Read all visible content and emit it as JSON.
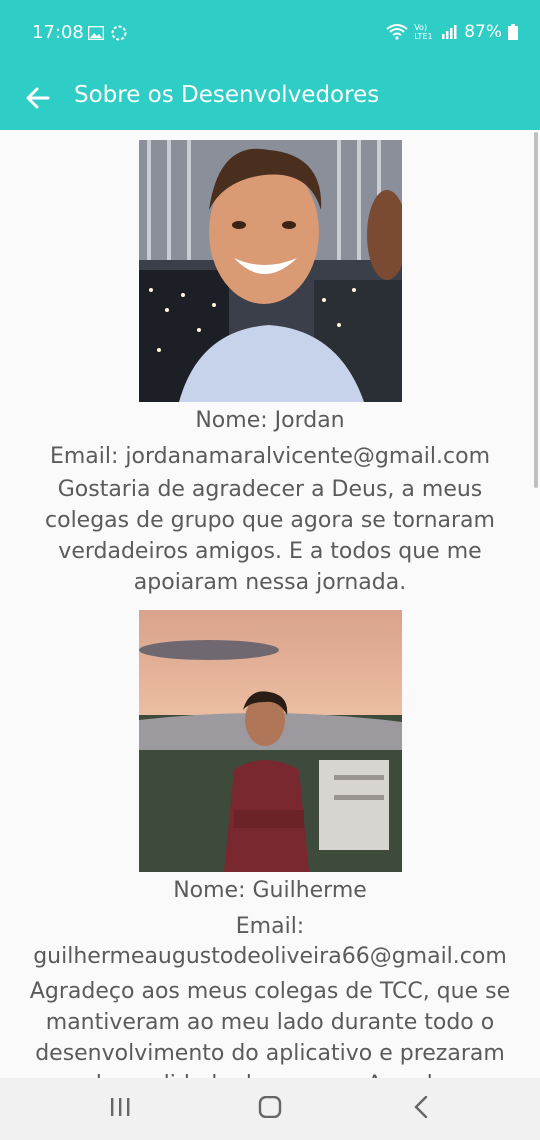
{
  "status": {
    "time": "17:08",
    "battery": "87%",
    "network": "Vo) LTE1"
  },
  "appbar": {
    "title": "Sobre os Desenvolvedores"
  },
  "developers": [
    {
      "name": "Nome: Jordan",
      "email": "Email: jordanamaralvicente@gmail.com",
      "message": "Gostaria de agradecer a Deus, a meus colegas de grupo que agora se tornaram verdadeiros amigos. E a todos que me apoiaram nessa jornada."
    },
    {
      "name": "Nome: Guilherme",
      "email": "Email: guilhermeaugustodeoliveira66@gmail.com",
      "message": "Agradeço aos meus colegas de TCC, que se mantiveram ao meu lado durante todo o desenvolvimento do aplicativo e prezaram pela qualidade do mesmo. Agradeço também"
    }
  ],
  "colors": {
    "accent": "#2ecdc5",
    "background": "#fafafa",
    "text": "#5b5b5b"
  },
  "navbar": {
    "recents": "recents-icon",
    "home": "home-icon",
    "back": "back-icon"
  }
}
